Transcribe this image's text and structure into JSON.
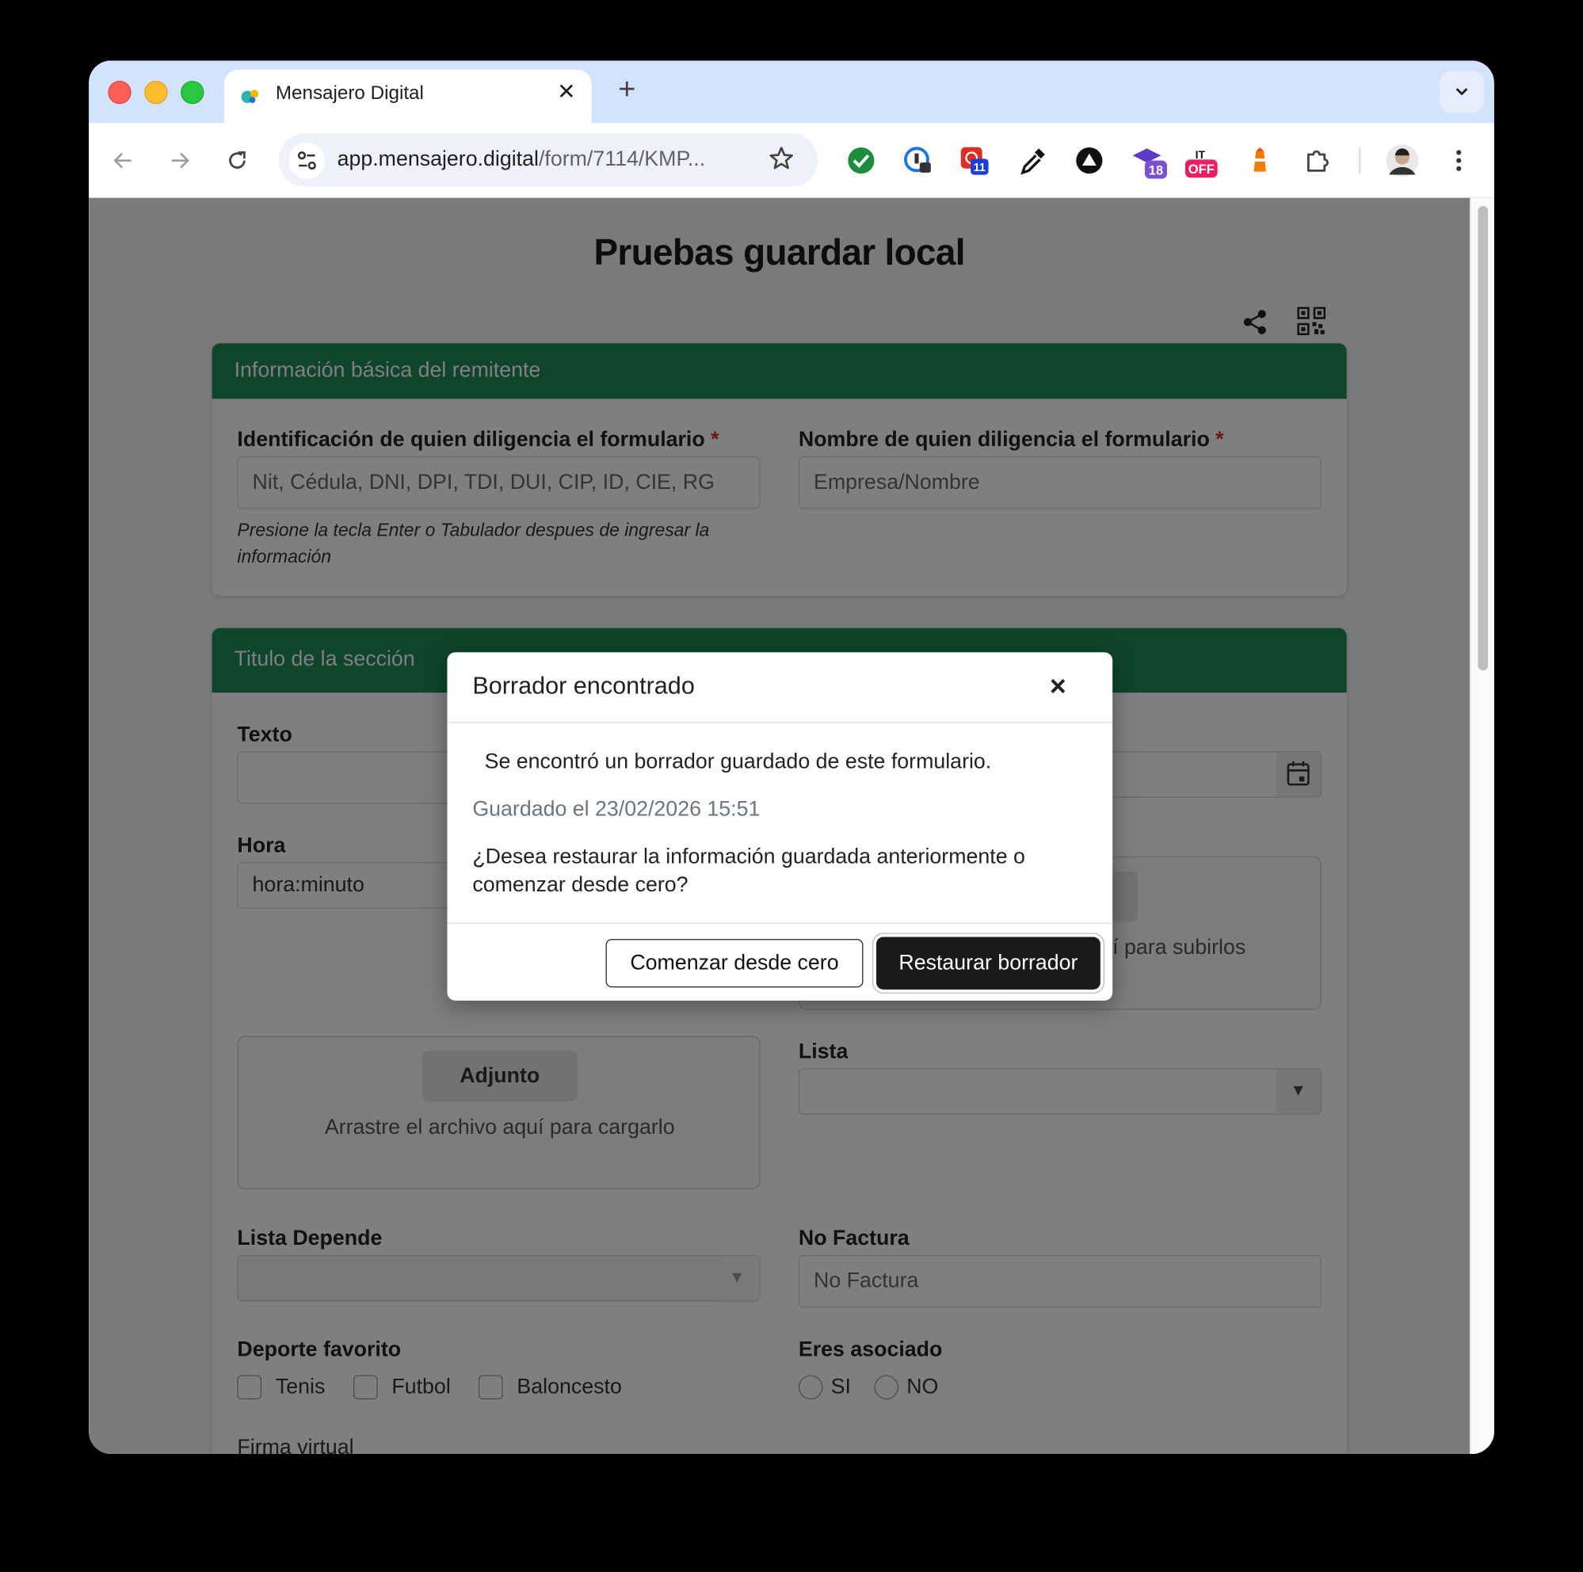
{
  "browser": {
    "tab_title": "Mensajero Digital",
    "tab_close": "✕",
    "new_tab": "+",
    "url_host": "app.mensajero.digital",
    "url_path": "/form/7114/KMP...",
    "extensions": [
      {
        "name": "green-check-extension-icon",
        "color": "#1e8e3e"
      },
      {
        "name": "password-manager-extension-icon",
        "color": "#1a73e8"
      },
      {
        "name": "red-extension-icon",
        "color": "#d93025",
        "badge": "11"
      },
      {
        "name": "eyedropper-extension-icon",
        "color": "#111111"
      },
      {
        "name": "triangle-extension-icon",
        "color": "#111111"
      },
      {
        "name": "graduation-cap-extension-icon",
        "color": "#5b3cc4",
        "badge": "18"
      },
      {
        "name": "offer-extension-icon",
        "color": "#e91e63",
        "badge": "OFF"
      },
      {
        "name": "lighthouse-extension-icon",
        "color": "#f57c00"
      },
      {
        "name": "puzzle-extension-icon",
        "color": "#444444"
      }
    ]
  },
  "page": {
    "title": "Pruebas guardar local"
  },
  "section1": {
    "header": "Información básica del remitente",
    "id_label": "Identificación de quien diligencia el formulario",
    "id_placeholder": "Nit, Cédula, DNI, DPI, TDI, DUI, CIP, ID, CIE, RG",
    "id_help_line1": "Presione la tecla Enter o Tabulador despues de ingresar la",
    "id_help_line2": "información",
    "name_label": "Nombre de quien diligencia el formulario",
    "name_placeholder": "Empresa/Nombre",
    "required_mark": "*"
  },
  "section2": {
    "header": "Titulo de la sección",
    "texto_label": "Texto",
    "hora_label": "Hora",
    "hora_placeholder": "hora:minuto",
    "files_hint_partial": "í para subirlos",
    "adjunto_button": "Adjunto",
    "adjunto_hint": "Arrastre el archivo aquí para cargarlo",
    "lista_label": "Lista",
    "lista_depende_label": "Lista Depende",
    "no_factura_label": "No Factura",
    "no_factura_placeholder": "No Factura",
    "deporte_label": "Deporte favorito",
    "deporte_options": [
      "Tenis",
      "Futbol",
      "Baloncesto"
    ],
    "asociado_label": "Eres asociado",
    "asociado_options": [
      "SI",
      "NO"
    ],
    "firma_label": "Firma virtual"
  },
  "modal": {
    "title": "Borrador encontrado",
    "close": "×",
    "message": "Se encontró un borrador guardado de este formulario.",
    "saved_at": "Guardado el 23/02/2026 15:51",
    "question": "¿Desea restaurar la información guardada anteriormente o comenzar desde cero?",
    "start_over_button": "Comenzar desde cero",
    "restore_button": "Restaurar borrador"
  },
  "colors": {
    "section_header": "#1e8a57",
    "primary_dark": "#1a1a1a",
    "required": "#d32f2f"
  }
}
